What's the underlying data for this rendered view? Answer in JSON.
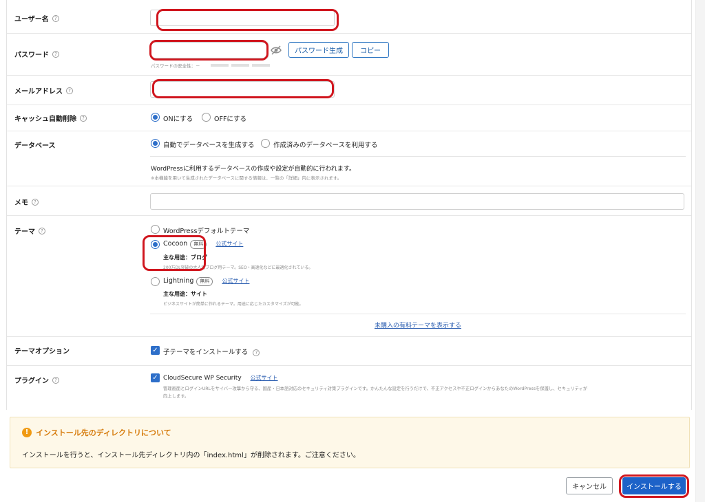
{
  "form": {
    "username": {
      "label": "ユーザー名"
    },
    "password": {
      "label": "パスワード",
      "generate_label": "パスワード生成",
      "copy_label": "コピー",
      "strength_text": "パスワードの安全性：－"
    },
    "email": {
      "label": "メールアドレス"
    },
    "cache": {
      "label": "キャッシュ自動削除",
      "on_label": "ONにする",
      "off_label": "OFFにする",
      "selected": "ON"
    },
    "database": {
      "label": "データベース",
      "auto_label": "自動でデータベースを生成する",
      "existing_label": "作成済みのデータベースを利用する",
      "note": "WordPressに利用するデータベースの作成や設定が自動的に行われます。",
      "subnote": "※本機能を用いて生成されたデータベースに関する情報は、一覧の「詳細」内に表示されます。"
    },
    "memo": {
      "label": "メモ"
    },
    "theme": {
      "label": "テーマ",
      "default_label": "WordPressデフォルトテーマ",
      "cocoon": {
        "name": "Cocoon",
        "badge": "無料",
        "link": "公式サイト",
        "usage": "主な用途：ブログ",
        "description": "200万DL突破の大人気ブログ用テーマ。SEO・高速化などに最適化されている。"
      },
      "lightning": {
        "name": "Lightning",
        "badge": "無料",
        "link": "公式サイト",
        "usage": "主な用途：サイト",
        "description": "ビジネスサイトが簡単に作れるテーマ。用途に応じたカスタマイズが可能。"
      },
      "more_link": "未購入の有料テーマを表示する",
      "selected": "Cocoon"
    },
    "theme_option": {
      "label": "テーマオプション",
      "child_label": "子テーマをインストールする",
      "checked": true
    },
    "plugin": {
      "label": "プラグイン",
      "name": "CloudSecure WP Security",
      "link": "公式サイト",
      "description_1": "管理画面とログインURLをサイバー攻撃から守る、国産・日本語対応のセキュリティ対策プラグインです。かんたんな設定を行うだけで、不正アクセスや不正ログインからあなたのWordPressを保護し、セキュリティが",
      "description_2": "向上します。",
      "checked": true
    }
  },
  "notice": {
    "title": "インストール先のディレクトリについて",
    "body": "インストールを行うと、インストール先ディレクトリ内の「index.html」が削除されます。ご注意ください。"
  },
  "actions": {
    "cancel_label": "キャンセル",
    "install_label": "インストールする"
  },
  "colors": {
    "accent": "#1d62c8",
    "annotation": "#d0161e",
    "warning": "#f09a13"
  },
  "icons": [
    "help-icon",
    "eye-slash-icon",
    "warning-icon",
    "check-icon"
  ]
}
